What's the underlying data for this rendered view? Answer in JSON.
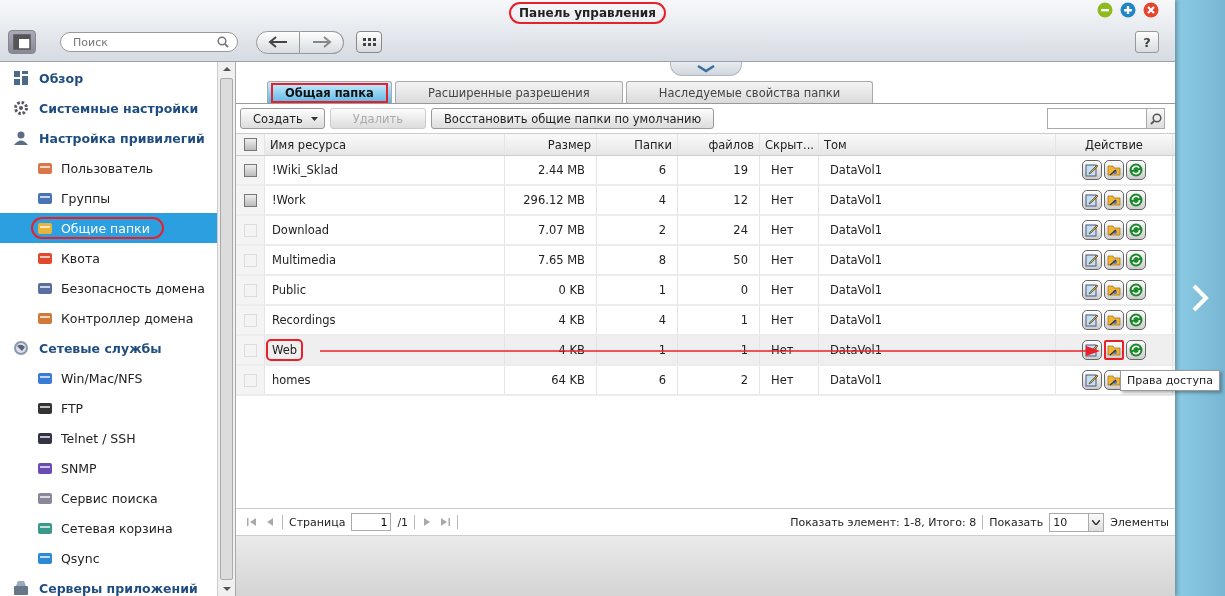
{
  "window": {
    "title": "Панель управления",
    "title_circled": true
  },
  "toolbar": {
    "search": {
      "placeholder": "Поиск"
    },
    "help": "?"
  },
  "sidebar": {
    "items": [
      {
        "label": "Обзор",
        "selected": false,
        "circled": false
      },
      {
        "label": "Системные настройки",
        "selected": false,
        "circled": false
      },
      {
        "label": "Настройка привилегий",
        "selected": false,
        "circled": false,
        "children": [
          {
            "label": "Пользователь",
            "selected": false,
            "circled": false
          },
          {
            "label": "Группы",
            "selected": false,
            "circled": false
          },
          {
            "label": "Общие папки",
            "selected": true,
            "circled": true
          },
          {
            "label": "Квота",
            "selected": false,
            "circled": false
          },
          {
            "label": "Безопасность домена",
            "selected": false,
            "circled": false
          },
          {
            "label": "Контроллер домена",
            "selected": false,
            "circled": false
          }
        ]
      },
      {
        "label": "Сетевые службы",
        "selected": false,
        "circled": false,
        "children": [
          {
            "label": "Win/Mac/NFS",
            "selected": false,
            "circled": false
          },
          {
            "label": "FTP",
            "selected": false,
            "circled": false
          },
          {
            "label": "Telnet / SSH",
            "selected": false,
            "circled": false
          },
          {
            "label": "SNMP",
            "selected": false,
            "circled": false
          },
          {
            "label": "Сервис поиска",
            "selected": false,
            "circled": false
          },
          {
            "label": "Сетевая корзина",
            "selected": false,
            "circled": false
          },
          {
            "label": "Qsync",
            "selected": false,
            "circled": false
          }
        ]
      },
      {
        "label": "Серверы приложений",
        "selected": false,
        "circled": false
      }
    ]
  },
  "tabs": [
    {
      "label": "Общая папка",
      "selected": true,
      "circled": true
    },
    {
      "label": "Расширенные разрешения",
      "selected": false,
      "circled": false
    },
    {
      "label": "Наследуемые свойства папки",
      "selected": false,
      "circled": false
    }
  ],
  "actions": [
    {
      "label": "Создать",
      "kind": "dropdown",
      "disabled": false
    },
    {
      "label": "Удалить",
      "kind": "button",
      "disabled": true
    },
    {
      "label": "Восстановить общие папки по умолчанию",
      "kind": "button",
      "disabled": false
    }
  ],
  "table": {
    "select_all_checked": false,
    "columns": [
      "Имя ресурса",
      "Размер",
      "Папки",
      "файлов",
      "Скрыт...",
      "Том",
      "Действие"
    ],
    "rows": [
      {
        "name": "!Wiki_Sklad",
        "size": "2.44 MB",
        "folders": "6",
        "files": "19",
        "hidden": "Нет",
        "volume": "DataVol1",
        "disabled": false,
        "highlighted": false,
        "annotated": false
      },
      {
        "name": "!Work",
        "size": "296.12 MB",
        "folders": "4",
        "files": "12",
        "hidden": "Нет",
        "volume": "DataVol1",
        "disabled": false,
        "highlighted": false,
        "annotated": false
      },
      {
        "name": "Download",
        "size": "7.07 MB",
        "folders": "2",
        "files": "24",
        "hidden": "Нет",
        "volume": "DataVol1",
        "disabled": true,
        "highlighted": false,
        "annotated": false
      },
      {
        "name": "Multimedia",
        "size": "7.65 MB",
        "folders": "8",
        "files": "50",
        "hidden": "Нет",
        "volume": "DataVol1",
        "disabled": true,
        "highlighted": false,
        "annotated": false
      },
      {
        "name": "Public",
        "size": "0 KB",
        "folders": "1",
        "files": "0",
        "hidden": "Нет",
        "volume": "DataVol1",
        "disabled": true,
        "highlighted": false,
        "annotated": false
      },
      {
        "name": "Recordings",
        "size": "4 KB",
        "folders": "4",
        "files": "1",
        "hidden": "Нет",
        "volume": "DataVol1",
        "disabled": true,
        "highlighted": false,
        "annotated": false
      },
      {
        "name": "Web",
        "size": "4 KB",
        "folders": "1",
        "files": "1",
        "hidden": "Нет",
        "volume": "DataVol1",
        "disabled": true,
        "highlighted": true,
        "annotated": true
      },
      {
        "name": "homes",
        "size": "64 KB",
        "folders": "6",
        "files": "2",
        "hidden": "Нет",
        "volume": "DataVol1",
        "disabled": true,
        "highlighted": false,
        "annotated": false
      }
    ],
    "tooltip": "Права доступа"
  },
  "pager": {
    "page_label": "Страница",
    "page": "1",
    "of": "/1",
    "summary": "Показать элемент: 1-8, Итого: 8",
    "show_label": "Показать",
    "per_page": "10",
    "items_label": "Элементы"
  }
}
